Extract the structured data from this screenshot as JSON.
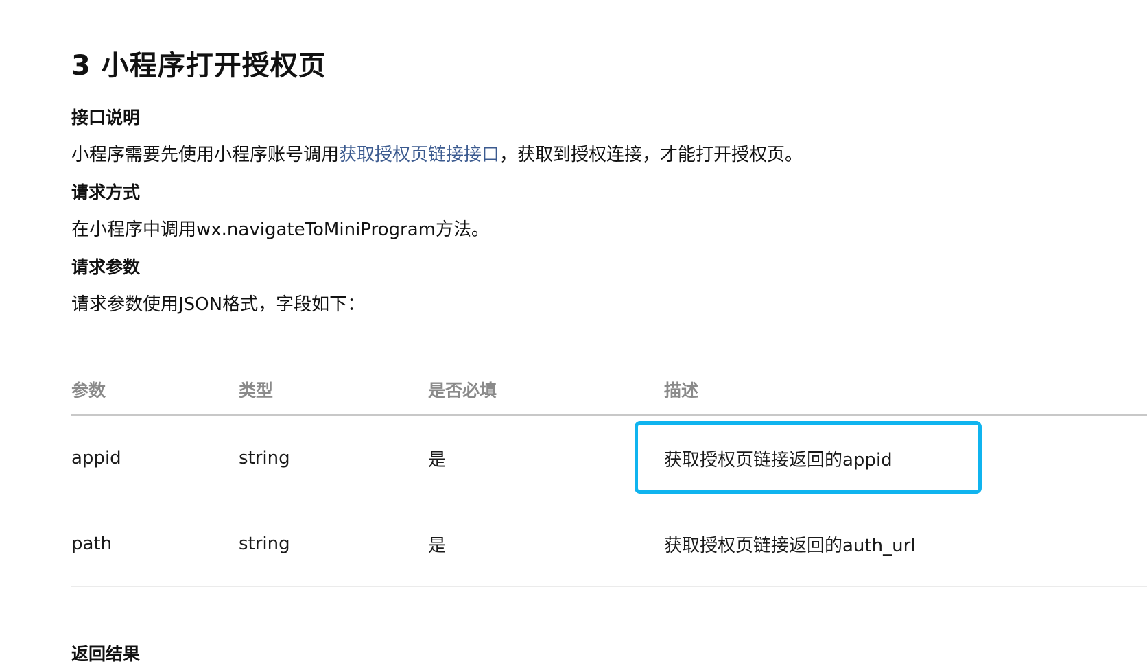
{
  "section": {
    "title": "3 小程序打开授权页"
  },
  "interface_desc": {
    "heading": "接口说明",
    "text_before": "小程序需要先使用小程序账号调用",
    "link_text": "获取授权页链接接口",
    "text_after": "，获取到授权连接，才能打开授权页。"
  },
  "request_method": {
    "heading": "请求方式",
    "text": "在小程序中调用wx.navigateToMiniProgram方法。"
  },
  "request_params": {
    "heading": "请求参数",
    "text": "请求参数使用JSON格式，字段如下："
  },
  "table": {
    "headers": [
      "参数",
      "类型",
      "是否必填",
      "描述"
    ],
    "rows": [
      [
        "appid",
        "string",
        "是",
        "获取授权页链接返回的appid"
      ],
      [
        "path",
        "string",
        "是",
        "获取授权页链接返回的auth_url"
      ]
    ],
    "highlight_color": "#10b4ef"
  },
  "next_section": {
    "heading": "返回结果"
  },
  "colors": {
    "link": "#3b5a8f",
    "header_text": "#8a8a8a",
    "highlight": "#10b4ef"
  }
}
